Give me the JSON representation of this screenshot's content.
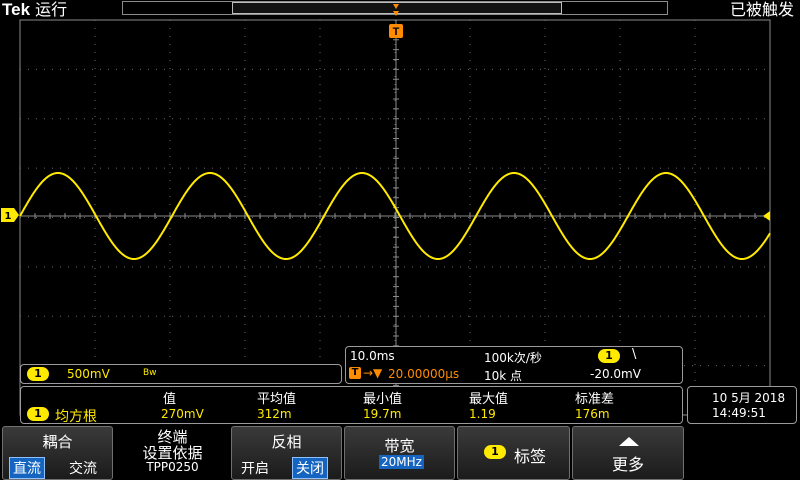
{
  "top": {
    "brand": "Tek",
    "run_state": "运行",
    "trigger_state": "已被触发"
  },
  "channel": {
    "number": "1",
    "scale": "500mV",
    "bw_icon": "Bw",
    "trace_color": "#ffea00"
  },
  "horizontal": {
    "time_div": "10.0ms",
    "sample_rate": "100k次/秒",
    "position": "20.00000µs",
    "record_length": "10k 点",
    "trigger_level": "-20.0mV",
    "trigger_slope_icon": "falling-edge-icon",
    "trigger_marker": "T"
  },
  "measurement": {
    "headers": [
      "值",
      "平均值",
      "最小值",
      "最大值",
      "标准差"
    ],
    "name": "均方根",
    "values": [
      "270mV",
      "312m",
      "19.7m",
      "1.19",
      "176m"
    ]
  },
  "datetime": {
    "date": "10 5月 2018",
    "time": "14:49:51"
  },
  "menu": {
    "coupling": {
      "title": "耦合",
      "option_a": "直流",
      "option_b": "交流"
    },
    "termination": {
      "line1": "终端",
      "line2": "设置依据",
      "line3": "TPP0250"
    },
    "invert": {
      "title": "反相",
      "option_a": "开启",
      "option_b": "关闭"
    },
    "bandwidth": {
      "title": "带宽",
      "value": "20MHz"
    },
    "label": {
      "title": "标签"
    },
    "more": {
      "title": "更多"
    }
  }
}
